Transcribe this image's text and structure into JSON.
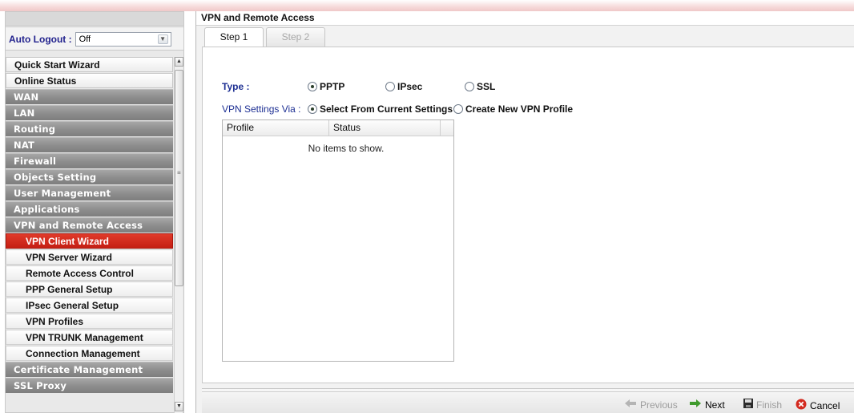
{
  "sidebar": {
    "auto_logout_label": "Auto Logout :",
    "auto_logout_value": "Off",
    "items": [
      {
        "label": "Quick Start Wizard",
        "kind": "top"
      },
      {
        "label": "Online Status",
        "kind": "top"
      },
      {
        "label": "WAN",
        "kind": "group"
      },
      {
        "label": "LAN",
        "kind": "group"
      },
      {
        "label": "Routing",
        "kind": "group"
      },
      {
        "label": "NAT",
        "kind": "group"
      },
      {
        "label": "Firewall",
        "kind": "group"
      },
      {
        "label": "Objects Setting",
        "kind": "group"
      },
      {
        "label": "User Management",
        "kind": "group"
      },
      {
        "label": "Applications",
        "kind": "group"
      },
      {
        "label": "VPN and Remote Access",
        "kind": "group"
      },
      {
        "label": "VPN Client Wizard",
        "kind": "sub",
        "active": true
      },
      {
        "label": "VPN Server Wizard",
        "kind": "sub"
      },
      {
        "label": "Remote Access Control",
        "kind": "sub"
      },
      {
        "label": "PPP General Setup",
        "kind": "sub"
      },
      {
        "label": "IPsec General Setup",
        "kind": "sub"
      },
      {
        "label": "VPN Profiles",
        "kind": "sub"
      },
      {
        "label": "VPN TRUNK Management",
        "kind": "sub"
      },
      {
        "label": "Connection Management",
        "kind": "sub"
      },
      {
        "label": "Certificate Management",
        "kind": "group"
      },
      {
        "label": "SSL Proxy",
        "kind": "group"
      }
    ]
  },
  "main": {
    "title": "VPN and Remote Access",
    "tabs": [
      {
        "label": "Step 1",
        "active": true
      },
      {
        "label": "Step 2",
        "active": false
      }
    ],
    "type_label": "Type :",
    "type_options": [
      {
        "label": "PPTP",
        "selected": true
      },
      {
        "label": "IPsec",
        "selected": false
      },
      {
        "label": "SSL",
        "selected": false
      }
    ],
    "via_label": "VPN Settings Via :",
    "via_options": [
      {
        "label": "Select From Current Settings",
        "selected": true
      },
      {
        "label": "Create New VPN Profile",
        "selected": false
      }
    ],
    "grid": {
      "columns": [
        "Profile",
        "Status"
      ],
      "empty_text": "No items to show."
    }
  },
  "footer": {
    "previous": "Previous",
    "next": "Next",
    "finish": "Finish",
    "cancel": "Cancel"
  },
  "colors": {
    "accent_red": "#c51f14",
    "label_blue": "#1d2f93",
    "group_gray": "#8c8c8c"
  }
}
